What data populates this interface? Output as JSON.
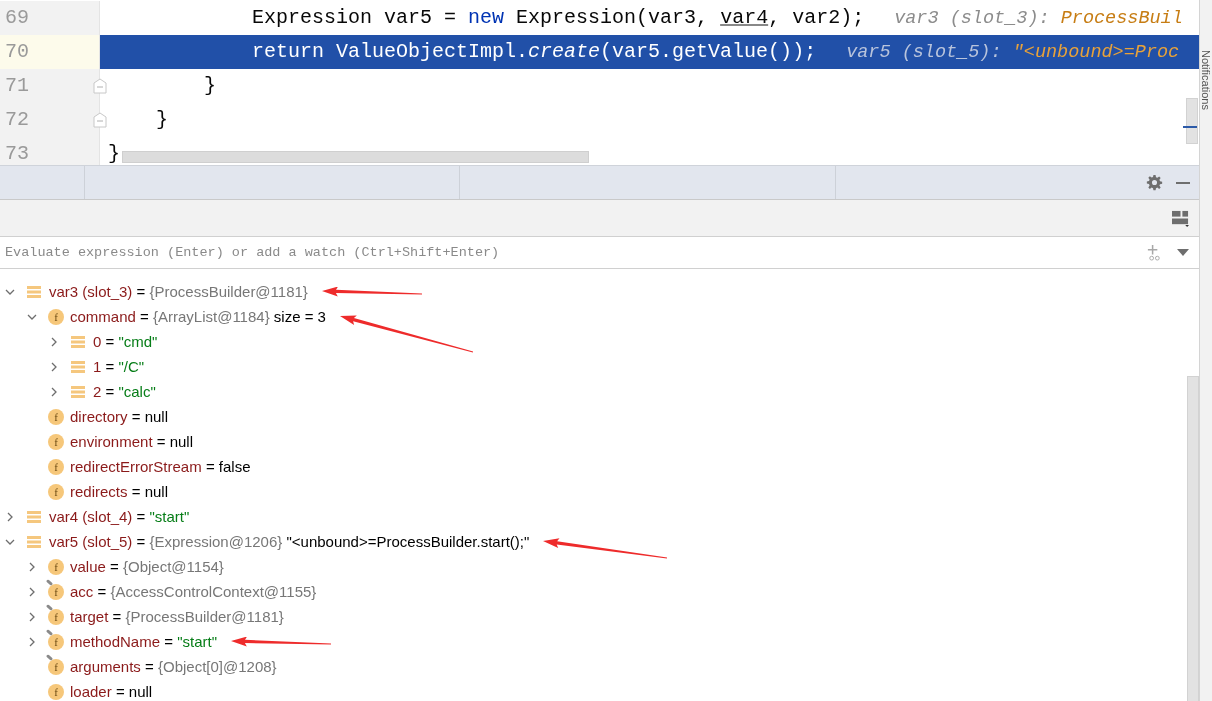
{
  "editor": {
    "lines": [
      {
        "number": "69",
        "selected": false,
        "tokens": [
          {
            "kind": "code",
            "text": "            Expression var5 = "
          },
          {
            "kind": "keyword",
            "text": "new"
          },
          {
            "kind": "code",
            "text": " Expression(var3, "
          },
          {
            "kind": "underline",
            "text": "var4"
          },
          {
            "kind": "code",
            "text": ", var2);"
          },
          {
            "kind": "hint",
            "text": "var3 (slot_3): "
          },
          {
            "kind": "hint-value",
            "text": "ProcessBuil"
          }
        ]
      },
      {
        "number": "70",
        "selected": true,
        "tokens": [
          {
            "kind": "code",
            "text": "            return ValueObjectImpl."
          },
          {
            "kind": "italic",
            "text": "create"
          },
          {
            "kind": "code",
            "text": "(var5.getValue());"
          },
          {
            "kind": "hint",
            "text": "var5 (slot_5): "
          },
          {
            "kind": "hint-value",
            "text": "\"<unbound>=Proc"
          }
        ]
      },
      {
        "number": "71",
        "selected": false,
        "fold": true,
        "tokens": [
          {
            "kind": "code",
            "text": "        }"
          }
        ]
      },
      {
        "number": "72",
        "selected": false,
        "fold": true,
        "tokens": [
          {
            "kind": "code",
            "text": "    }"
          }
        ]
      },
      {
        "number": "73",
        "selected": false,
        "tokens": [
          {
            "kind": "code",
            "text": "}"
          }
        ]
      }
    ]
  },
  "debugger": {
    "evaluate": {
      "placeholder": "Evaluate expression (Enter) or add a watch (Ctrl+Shift+Enter)"
    },
    "variables": [
      {
        "kind": "local",
        "expanded": true,
        "annotation": {
          "kind": "level"
        },
        "label": [
          {
            "kind": "name",
            "text": "var3 (slot_3)"
          },
          {
            "kind": "plain",
            "text": "="
          },
          {
            "kind": "ref",
            "text": "{ProcessBuilder@1181}"
          }
        ],
        "children": [
          {
            "kind": "field",
            "badge": "f",
            "expanded": true,
            "annotation": {
              "kind": "steep"
            },
            "label": [
              {
                "kind": "name",
                "text": "command"
              },
              {
                "kind": "plain",
                "text": "="
              },
              {
                "kind": "ref",
                "text": "{ArrayList@1184}"
              },
              {
                "kind": "plain",
                "text": "size = 3"
              }
            ],
            "children": [
              {
                "kind": "local",
                "expanded": false,
                "label": [
                  {
                    "kind": "name",
                    "text": "0"
                  },
                  {
                    "kind": "plain",
                    "text": "="
                  },
                  {
                    "kind": "string",
                    "text": "\"cmd\""
                  }
                ]
              },
              {
                "kind": "local",
                "expanded": false,
                "label": [
                  {
                    "kind": "name",
                    "text": "1"
                  },
                  {
                    "kind": "plain",
                    "text": "="
                  },
                  {
                    "kind": "string",
                    "text": "\"/C\""
                  }
                ]
              },
              {
                "kind": "local",
                "expanded": false,
                "label": [
                  {
                    "kind": "name",
                    "text": "2"
                  },
                  {
                    "kind": "plain",
                    "text": "="
                  },
                  {
                    "kind": "string",
                    "text": "\"calc\""
                  }
                ]
              }
            ]
          },
          {
            "kind": "field",
            "badge": "f",
            "label": [
              {
                "kind": "name",
                "text": "directory"
              },
              {
                "kind": "plain",
                "text": "="
              },
              {
                "kind": "plain",
                "text": "null"
              }
            ]
          },
          {
            "kind": "field",
            "badge": "f",
            "label": [
              {
                "kind": "name",
                "text": "environment"
              },
              {
                "kind": "plain",
                "text": "="
              },
              {
                "kind": "plain",
                "text": "null"
              }
            ]
          },
          {
            "kind": "field",
            "badge": "f",
            "label": [
              {
                "kind": "name",
                "text": "redirectErrorStream"
              },
              {
                "kind": "plain",
                "text": "="
              },
              {
                "kind": "plain",
                "text": "false"
              }
            ]
          },
          {
            "kind": "field",
            "badge": "f",
            "label": [
              {
                "kind": "name",
                "text": "redirects"
              },
              {
                "kind": "plain",
                "text": "="
              },
              {
                "kind": "plain",
                "text": "null"
              }
            ]
          }
        ]
      },
      {
        "kind": "local",
        "expanded": false,
        "label": [
          {
            "kind": "name",
            "text": "var4 (slot_4)"
          },
          {
            "kind": "plain",
            "text": "="
          },
          {
            "kind": "string",
            "text": "\"start\""
          }
        ]
      },
      {
        "kind": "local",
        "expanded": true,
        "annotation": {
          "kind": "slight"
        },
        "label": [
          {
            "kind": "name",
            "text": "var5 (slot_5)"
          },
          {
            "kind": "plain",
            "text": "="
          },
          {
            "kind": "ref",
            "text": "{Expression@1206}"
          },
          {
            "kind": "plain",
            "text": "\"<unbound>=ProcessBuilder.start();\""
          }
        ],
        "children": [
          {
            "kind": "field",
            "badge": "f",
            "expanded": false,
            "label": [
              {
                "kind": "name",
                "text": "value"
              },
              {
                "kind": "plain",
                "text": "="
              },
              {
                "kind": "ref",
                "text": "{Object@1154}"
              }
            ]
          },
          {
            "kind": "final-field",
            "badge": "f",
            "expanded": false,
            "label": [
              {
                "kind": "name",
                "text": "acc"
              },
              {
                "kind": "plain",
                "text": "="
              },
              {
                "kind": "ref",
                "text": "{AccessControlContext@1155}"
              }
            ]
          },
          {
            "kind": "final-field",
            "badge": "f",
            "expanded": false,
            "label": [
              {
                "kind": "name",
                "text": "target"
              },
              {
                "kind": "plain",
                "text": "="
              },
              {
                "kind": "ref",
                "text": "{ProcessBuilder@1181}"
              }
            ]
          },
          {
            "kind": "final-field",
            "badge": "f",
            "expanded": false,
            "annotation": {
              "kind": "level"
            },
            "label": [
              {
                "kind": "name",
                "text": "methodName"
              },
              {
                "kind": "plain",
                "text": "="
              },
              {
                "kind": "string",
                "text": "\"start\""
              }
            ]
          },
          {
            "kind": "final-field",
            "badge": "f",
            "label": [
              {
                "kind": "name",
                "text": "arguments"
              },
              {
                "kind": "plain",
                "text": "="
              },
              {
                "kind": "ref",
                "text": "{Object[0]@1208}"
              }
            ]
          },
          {
            "kind": "field",
            "badge": "f",
            "label": [
              {
                "kind": "name",
                "text": "loader"
              },
              {
                "kind": "plain",
                "text": "="
              },
              {
                "kind": "plain",
                "text": "null"
              }
            ]
          }
        ]
      }
    ]
  },
  "side_strip": {
    "label": "Notifications"
  }
}
